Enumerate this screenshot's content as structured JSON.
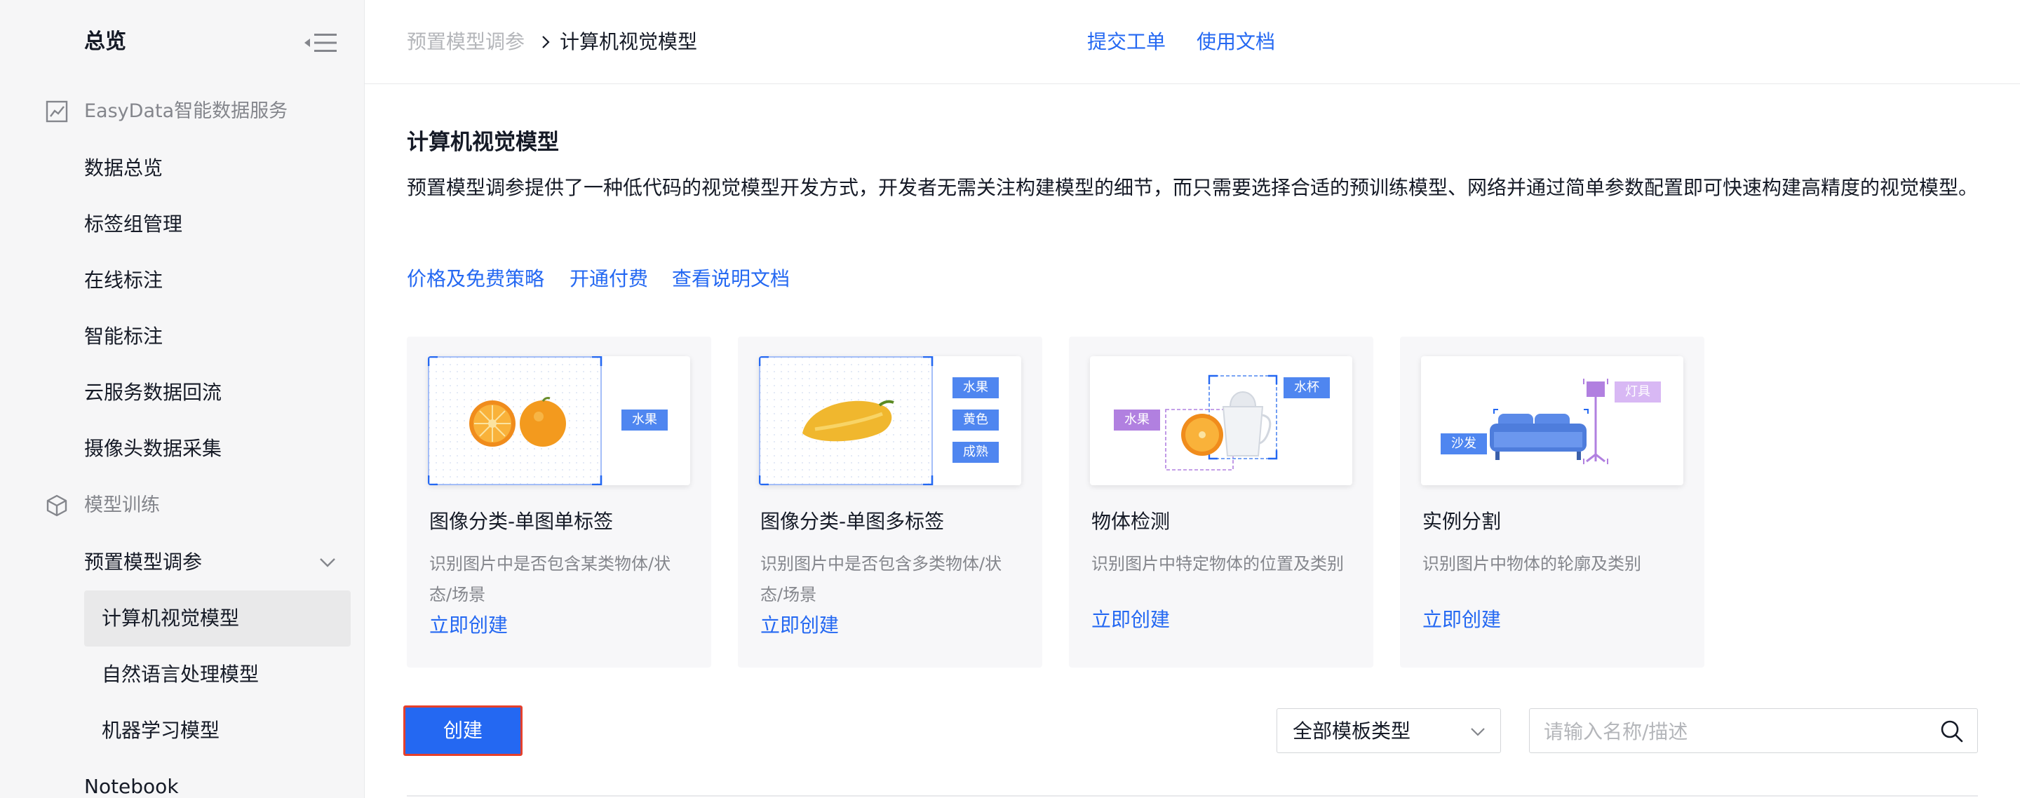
{
  "sidebar": {
    "title": "总览",
    "groups": [
      {
        "label": "EasyData智能数据服务",
        "icon": "chart-line-icon",
        "items": [
          {
            "label": "数据总览"
          },
          {
            "label": "标签组管理"
          },
          {
            "label": "在线标注"
          },
          {
            "label": "智能标注"
          },
          {
            "label": "云服务数据回流"
          },
          {
            "label": "摄像头数据采集"
          }
        ]
      },
      {
        "label": "模型训练",
        "icon": "cube-icon",
        "items": [
          {
            "label": "预置模型调参",
            "expanded": true,
            "children": [
              {
                "label": "计算机视觉模型",
                "active": true
              },
              {
                "label": "自然语言处理模型"
              },
              {
                "label": "机器学习模型"
              }
            ]
          },
          {
            "label": "Notebook"
          }
        ]
      }
    ]
  },
  "header": {
    "breadcrumb": {
      "parent": "预置模型调参",
      "current": "计算机视觉模型"
    },
    "links": [
      {
        "label": "提交工单"
      },
      {
        "label": "使用文档"
      }
    ]
  },
  "main": {
    "title": "计算机视觉模型",
    "description": "预置模型调参提供了一种低代码的视觉模型开发方式，开发者无需关注构建模型的细节，而只需要选择合适的预训练模型、网络并通过简单参数配置即可快速构建高精度的视觉模型。",
    "links": [
      {
        "label": "价格及免费策略"
      },
      {
        "label": "开通付费"
      },
      {
        "label": "查看说明文档"
      }
    ],
    "cards": [
      {
        "title": "图像分类-单图单标签",
        "description": "识别图片中是否包含某类物体/状态/场景",
        "action": "立即创建",
        "tags": [
          "水果"
        ]
      },
      {
        "title": "图像分类-单图多标签",
        "description": "识别图片中是否包含多类物体/状态/场景",
        "action": "立即创建",
        "tags": [
          "水果",
          "黄色",
          "成熟"
        ]
      },
      {
        "title": "物体检测",
        "description": "识别图片中特定物体的位置及类别",
        "action": "立即创建",
        "tags": [
          "水果",
          "水杯"
        ]
      },
      {
        "title": "实例分割",
        "description": "识别图片中物体的轮廓及类别",
        "action": "立即创建",
        "tags": [
          "沙发",
          "灯具"
        ]
      }
    ]
  },
  "toolbar": {
    "create_label": "创建",
    "filter_selected": "全部模板类型",
    "search_placeholder": "请输入名称/描述"
  },
  "colors": {
    "accent": "#2468f2",
    "sidebar_bg": "#f6f6f7",
    "active_item_bg": "#e9e9ea",
    "card_bg": "#f7f7f9",
    "highlight_border": "#e4402c",
    "muted_text": "#84868c"
  }
}
